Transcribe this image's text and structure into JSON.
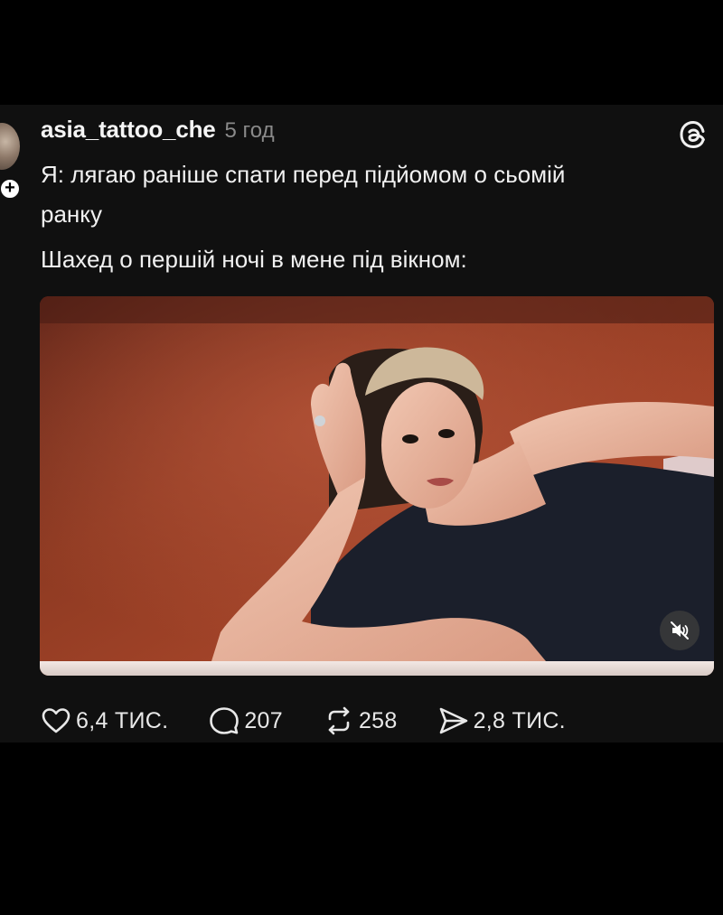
{
  "post": {
    "username": "asia_tattoo_che",
    "timestamp": "5 год",
    "text_lines": [
      "Я: лягаю раніше спати перед підйомом о сьомій",
      "ранку",
      "Шахед о першій ночі в мене під вікном:"
    ],
    "follow_badge": "+",
    "media": {
      "type": "video",
      "muted": true,
      "icon": "speaker-muted-icon"
    },
    "actions": {
      "likes": "6,4 ТИС.",
      "replies": "207",
      "reposts": "258",
      "shares": "2,8 ТИС."
    }
  },
  "icons": {
    "brand": "threads-logo-icon",
    "like": "heart-icon",
    "reply": "comment-icon",
    "repost": "repost-icon",
    "share": "send-icon"
  },
  "colors": {
    "background": "#000000",
    "card": "#101010",
    "text": "#f3f3f3",
    "muted_text": "#8a8a8a"
  }
}
